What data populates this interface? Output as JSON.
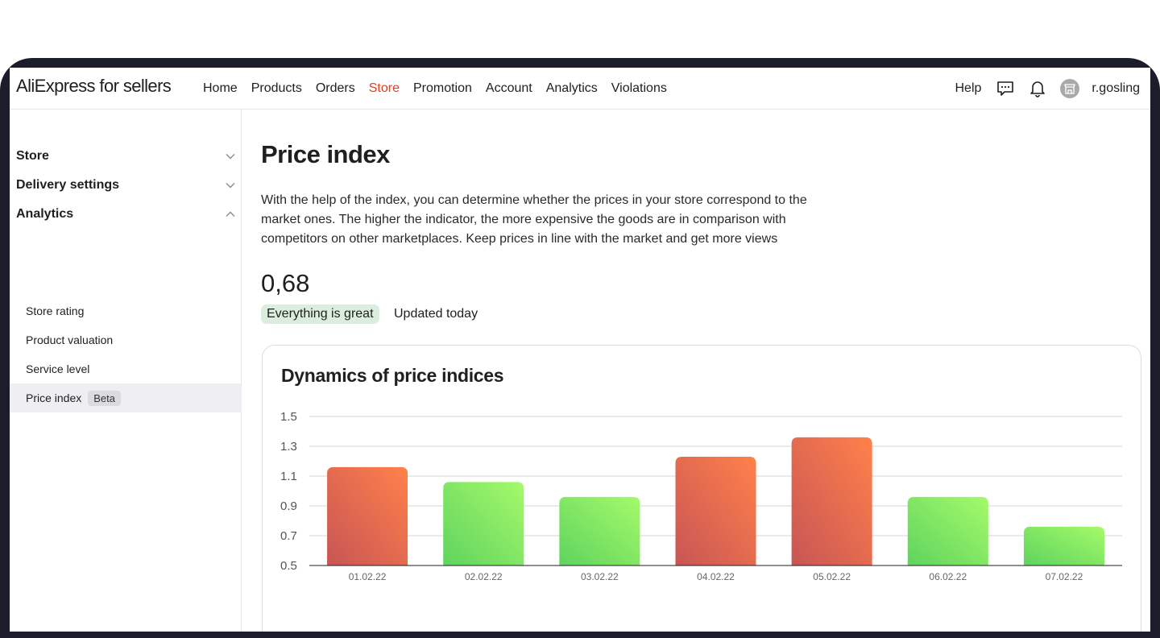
{
  "app": {
    "logo": "AliExpress for sellers"
  },
  "nav": {
    "items": [
      {
        "label": "Home"
      },
      {
        "label": "Products"
      },
      {
        "label": "Orders"
      },
      {
        "label": "Store",
        "active": true
      },
      {
        "label": "Promotion"
      },
      {
        "label": "Account"
      },
      {
        "label": "Analytics"
      },
      {
        "label": "Violations"
      }
    ],
    "help": "Help",
    "user": "r.gosling",
    "icons": [
      "message-icon",
      "bell-icon",
      "store-avatar-icon"
    ]
  },
  "sidebar": {
    "sections": [
      {
        "label": "Store",
        "expanded": false
      },
      {
        "label": "Delivery settings",
        "expanded": false
      },
      {
        "label": "Analytics",
        "expanded": true
      }
    ],
    "subitems": [
      {
        "label": "Store rating"
      },
      {
        "label": "Product valuation"
      },
      {
        "label": "Service level"
      },
      {
        "label": "Price index",
        "badge": "Beta",
        "active": true
      }
    ]
  },
  "main": {
    "title": "Price index",
    "description": "With the help of the index, you can determine whether the prices in your store correspond to the market ones. The higher the indicator, the more expensive the goods are in comparison with competitors on other marketplaces. Keep prices in line with the market and get more views",
    "value": "0,68",
    "status_badge": "Everything is great",
    "updated": "Updated today",
    "card_title": "Dynamics of price indices"
  },
  "colors": {
    "accent": "#e0401f",
    "good_start": "#5fd35f",
    "good_end": "#a5fa69",
    "bad_start": "#c85555",
    "bad_end": "#ff814a",
    "status_badge_bg": "#dbeedd"
  },
  "chart_data": {
    "type": "bar",
    "categories": [
      "01.02.22",
      "02.02.22",
      "03.02.22",
      "04.02.22",
      "05.02.22",
      "06.02.22",
      "07.02.22"
    ],
    "values": [
      1.16,
      1.06,
      0.96,
      1.23,
      1.36,
      0.96,
      0.76
    ],
    "status": [
      "bad",
      "good",
      "good",
      "bad",
      "bad",
      "good",
      "good"
    ],
    "yticks": [
      "1.5",
      "1.3",
      "1.1",
      "0.9",
      "0.7",
      "0.5"
    ],
    "ylim": [
      0.5,
      1.5
    ],
    "title": "Dynamics of price indices",
    "grid": true
  }
}
